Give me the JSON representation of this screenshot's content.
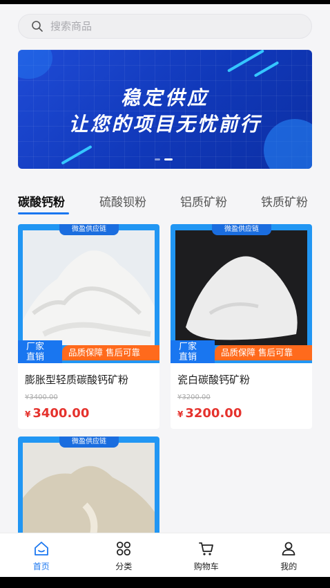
{
  "search": {
    "placeholder": "搜索商品",
    "icon": "search-icon"
  },
  "banner": {
    "line1": "稳定供应",
    "line2": "让您的项目无忧前行",
    "slides": 2,
    "active_slide": 1
  },
  "tabs": [
    {
      "label": "碳酸钙粉",
      "active": true
    },
    {
      "label": "硫酸钡粉",
      "active": false
    },
    {
      "label": "铝质矿粉",
      "active": false
    },
    {
      "label": "铁质矿粉",
      "active": false
    }
  ],
  "products": [
    {
      "supply_tag": "微盈供应链",
      "factory_tag": "厂家直销",
      "factory_l1": "厂家",
      "factory_l2": "直销",
      "quality_tag": "品质保障 售后可靠",
      "name": "膨胀型轻质碳酸钙矿粉",
      "original_price": "¥3400.00",
      "currency": "¥",
      "price": "3400.00"
    },
    {
      "supply_tag": "微盈供应链",
      "factory_tag": "厂家直销",
      "factory_l1": "厂家",
      "factory_l2": "直销",
      "quality_tag": "品质保障 售后可靠",
      "name": "瓷白碳酸钙矿粉",
      "original_price": "¥3200.00",
      "currency": "¥",
      "price": "3200.00"
    },
    {
      "supply_tag": "微盈供应链"
    }
  ],
  "bottom_nav": [
    {
      "label": "首页",
      "icon": "home-icon",
      "active": true
    },
    {
      "label": "分类",
      "icon": "category-icon",
      "active": false
    },
    {
      "label": "购物车",
      "icon": "cart-icon",
      "active": false
    },
    {
      "label": "我的",
      "icon": "user-icon",
      "active": false
    }
  ],
  "colors": {
    "accent": "#1976f0",
    "price": "#e5322d",
    "quality_tag": "#ff6a1c",
    "image_frame": "#2196f3"
  }
}
